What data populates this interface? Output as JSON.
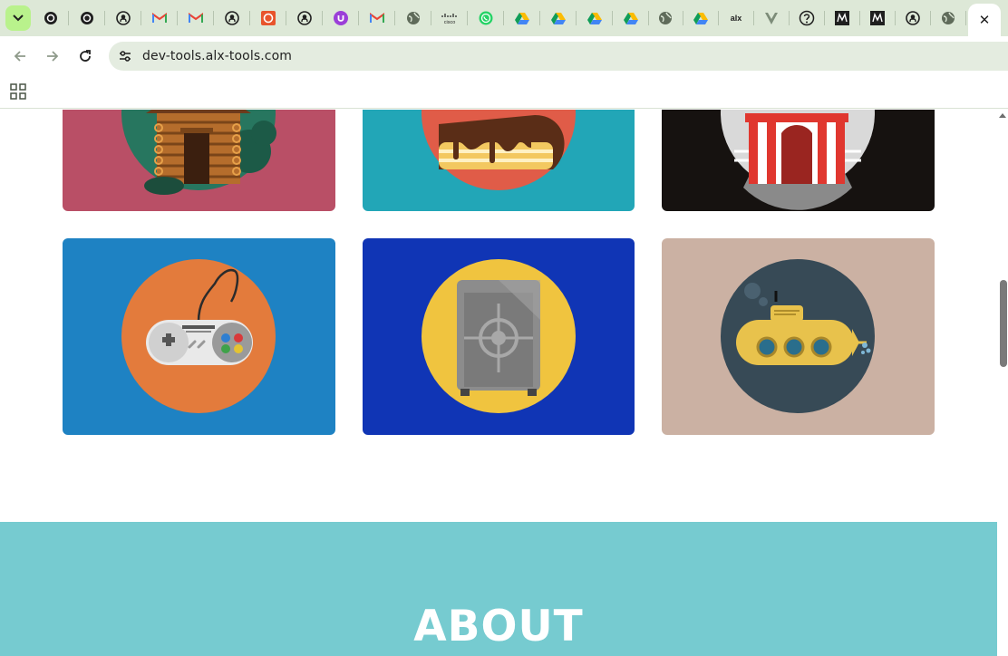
{
  "browser": {
    "url": "dev-tools.alx-tools.com",
    "tabs": [
      {
        "icon": "openai-icon"
      },
      {
        "icon": "openai-icon"
      },
      {
        "icon": "github-icon"
      },
      {
        "icon": "gmail-icon"
      },
      {
        "icon": "gmail-icon"
      },
      {
        "icon": "github-icon"
      },
      {
        "icon": "orange-app-icon"
      },
      {
        "icon": "github-icon"
      },
      {
        "icon": "purple-app-icon"
      },
      {
        "icon": "gmail-icon"
      },
      {
        "icon": "globe-icon"
      },
      {
        "icon": "cisco-icon",
        "text": "cisco"
      },
      {
        "icon": "whatsapp-icon"
      },
      {
        "icon": "google-drive-icon"
      },
      {
        "icon": "google-drive-icon"
      },
      {
        "icon": "google-drive-icon"
      },
      {
        "icon": "google-drive-icon"
      },
      {
        "icon": "globe-icon"
      },
      {
        "icon": "google-drive-icon"
      },
      {
        "icon": "alx-icon",
        "text": "alx"
      },
      {
        "icon": "vue-like-icon"
      },
      {
        "icon": "help-icon"
      },
      {
        "icon": "medium-icon"
      },
      {
        "icon": "medium-icon"
      },
      {
        "icon": "github-icon"
      },
      {
        "icon": "globe-icon"
      }
    ],
    "active_tab": {
      "icon": "close-icon",
      "close_label": "✕"
    }
  },
  "portfolio": {
    "cards": [
      {
        "name": "cabin",
        "bg": "#b94f66",
        "circle": "#27765f"
      },
      {
        "name": "cake",
        "bg": "#22a6b7",
        "circle": "#e05c48"
      },
      {
        "name": "circus",
        "bg": "#161210",
        "circle": "#d9d9d9"
      },
      {
        "name": "game-controller",
        "bg": "#1e82c3",
        "circle": "#e37b3c"
      },
      {
        "name": "safe",
        "bg": "#1035b5",
        "circle": "#f0c43f"
      },
      {
        "name": "submarine",
        "bg": "#cbb1a3",
        "circle": "#374a56"
      }
    ]
  },
  "about": {
    "title": "ABOUT",
    "bg": "#76cbd0"
  }
}
